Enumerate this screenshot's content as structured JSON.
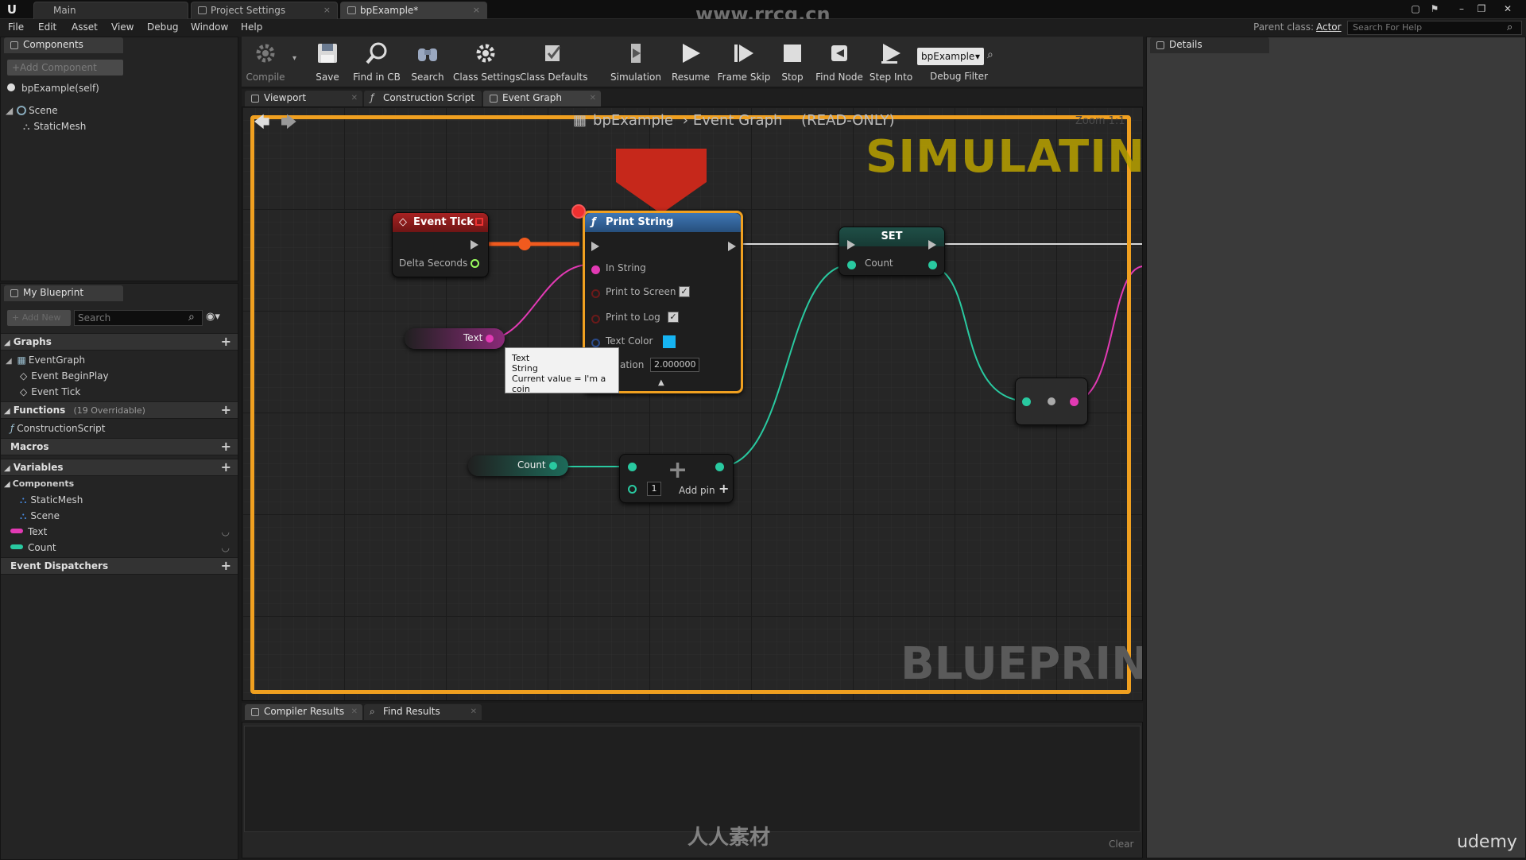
{
  "window": {
    "tabs": [
      {
        "label": "Main"
      },
      {
        "label": "Project Settings"
      },
      {
        "label": "bpExample*"
      }
    ],
    "watermark_top": "www.rrcg.cn"
  },
  "menu": {
    "items": [
      "File",
      "Edit",
      "Asset",
      "View",
      "Debug",
      "Window",
      "Help"
    ],
    "parent_class_label": "Parent class:",
    "parent_class_value": "Actor",
    "help_search_placeholder": "Search For Help"
  },
  "components_panel": {
    "tab": "Components",
    "add_button": "+Add Component",
    "self_item": "bpExample(self)",
    "tree": [
      {
        "label": "Scene"
      },
      {
        "label": "StaticMesh"
      }
    ]
  },
  "my_blueprint": {
    "tab": "My Blueprint",
    "add_new": "+ Add New",
    "search_placeholder": "Search",
    "graphs": {
      "header": "Graphs",
      "items": [
        "EventGraph",
        "Event BeginPlay",
        "Event Tick"
      ]
    },
    "functions": {
      "header": "Functions",
      "sub": "(19 Overridable)",
      "items": [
        "ConstructionScript"
      ]
    },
    "macros": {
      "header": "Macros"
    },
    "variables": {
      "header": "Variables",
      "components_header": "Components",
      "component_items": [
        "StaticMesh",
        "Scene"
      ],
      "vars": [
        {
          "name": "Text",
          "color": "#e23ab4"
        },
        {
          "name": "Count",
          "color": "#29c9a0"
        }
      ]
    },
    "event_dispatchers": {
      "header": "Event Dispatchers"
    }
  },
  "toolbar": {
    "buttons": [
      {
        "label": "Compile",
        "icon": "compile-gear-icon"
      },
      {
        "label": "Save",
        "icon": "save-disk-icon"
      },
      {
        "label": "Find in CB",
        "icon": "find-in-cb-icon"
      },
      {
        "label": "Search",
        "icon": "binoculars-icon"
      },
      {
        "label": "Class Settings",
        "icon": "class-settings-gear-icon"
      },
      {
        "label": "Class Defaults",
        "icon": "class-defaults-icon"
      },
      {
        "label": "Simulation",
        "icon": "simulation-icon"
      },
      {
        "label": "Resume",
        "icon": "resume-play-icon"
      },
      {
        "label": "Frame Skip",
        "icon": "frame-skip-icon"
      },
      {
        "label": "Stop",
        "icon": "stop-square-icon"
      },
      {
        "label": "Find Node",
        "icon": "find-node-icon"
      },
      {
        "label": "Step Into",
        "icon": "step-into-icon"
      }
    ],
    "debug_dropdown_value": "bpExample",
    "debug_filter_label": "Debug Filter"
  },
  "editor_tabs": [
    {
      "label": "Viewport"
    },
    {
      "label": "Construction Script"
    },
    {
      "label": "Event Graph"
    }
  ],
  "graph": {
    "breadcrumb_root": "bpExample",
    "breadcrumb_current": "Event Graph",
    "read_only": "(READ-ONLY)",
    "zoom": "Zoom 1:1",
    "simulating": "SIMULATING",
    "blueprint_watermark": "BLUEPRINT",
    "event_tick": {
      "title": "Event Tick",
      "delta": "Delta Seconds"
    },
    "print_string": {
      "title": "Print String",
      "in_string": "In String",
      "print_to_screen": "Print to Screen",
      "print_to_log": "Print to Log",
      "text_color": "Text Color",
      "text_color_value": "#16b4f2",
      "duration_label": "ation",
      "duration_value": "2.000000"
    },
    "set_node": {
      "title": "SET",
      "count": "Count"
    },
    "text_var": "Text",
    "count_var": "Count",
    "add_node": {
      "value": "1",
      "add_pin": "Add pin"
    },
    "tooltip": {
      "line1": "Text",
      "line2": "String",
      "line3": "Current value = I'm a coin"
    }
  },
  "bottom_tabs": [
    {
      "label": "Compiler Results"
    },
    {
      "label": "Find Results"
    }
  ],
  "bottom": {
    "clear": "Clear",
    "watermark": "人人素材",
    "udemy": "udemy"
  },
  "details": {
    "tab": "Details"
  }
}
